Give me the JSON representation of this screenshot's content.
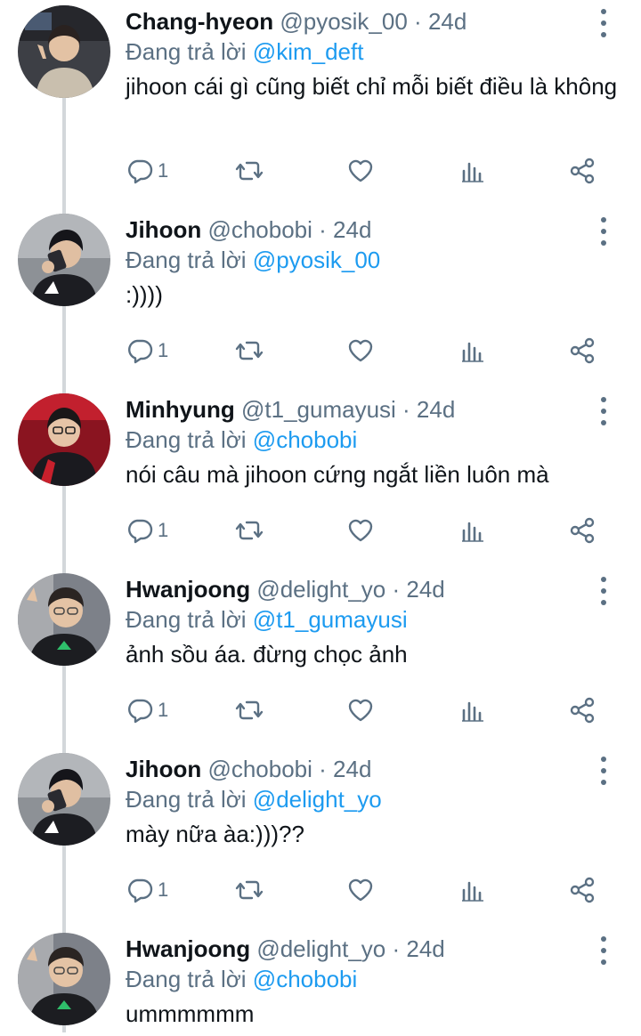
{
  "replying_label": "Đang trả lời",
  "tweets": [
    {
      "name": "Chang-hyeon",
      "handle": "@pyosik_00",
      "sep": " · ",
      "time": "24d",
      "replying_to": "@kim_deft",
      "text": "jihoon cái gì cũng biết chỉ mỗi biết điều là không",
      "reply_count": "1",
      "avatar": "avatar-changhyeon"
    },
    {
      "name": "Jihoon",
      "handle": "@chobobi",
      "sep": " · ",
      "time": "24d",
      "replying_to": "@pyosik_00",
      "text": ":))))",
      "reply_count": "1",
      "avatar": "avatar-jihoon"
    },
    {
      "name": "Minhyung",
      "handle": "@t1_gumayusi",
      "sep": " · ",
      "time": "24d",
      "replying_to": "@chobobi",
      "text": "nói câu mà jihoon cứng ngắt liền luôn mà",
      "reply_count": "1",
      "avatar": "avatar-minhyung"
    },
    {
      "name": "Hwanjoong",
      "handle": "@delight_yo",
      "sep": " · ",
      "time": "24d",
      "replying_to": "@t1_gumayusi",
      "text": "ảnh sồu áa. đừng chọc ảnh",
      "reply_count": "1",
      "avatar": "avatar-hwanjoong"
    },
    {
      "name": "Jihoon",
      "handle": "@chobobi",
      "sep": " · ",
      "time": "24d",
      "replying_to": "@delight_yo",
      "text": "mày nữa àa:)))??",
      "reply_count": "1",
      "avatar": "avatar-jihoon"
    },
    {
      "name": "Hwanjoong",
      "handle": "@delight_yo",
      "sep": " · ",
      "time": "24d",
      "replying_to": "@chobobi",
      "text": "ummmmmm",
      "reply_count": "",
      "avatar": "avatar-hwanjoong"
    }
  ],
  "colors": {
    "link": "#1d9bf0",
    "secondary": "#5b7083",
    "thread_line": "#d3d7da"
  },
  "icons": [
    "more-icon",
    "reply-icon",
    "retweet-icon",
    "like-icon",
    "analytics-icon",
    "share-icon"
  ]
}
